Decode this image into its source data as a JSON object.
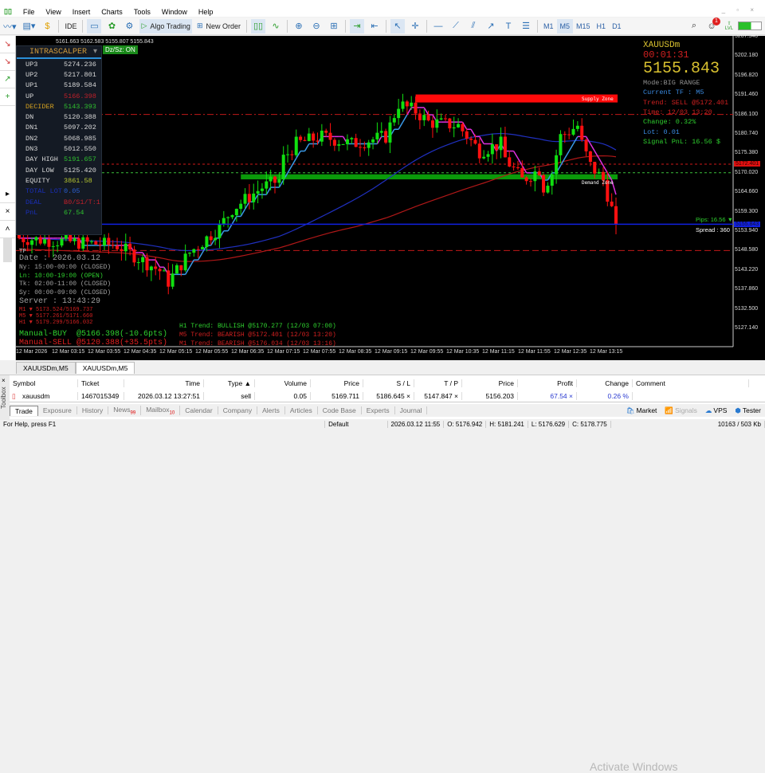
{
  "menu": [
    "File",
    "View",
    "Insert",
    "Charts",
    "Tools",
    "Window",
    "Help"
  ],
  "toolbar": {
    "algo_trading": "Algo Trading",
    "new_order": "New Order",
    "ide": "IDE",
    "timeframes": [
      "M1",
      "M5",
      "M15",
      "H1",
      "D1"
    ],
    "active_tf": "M5",
    "notifications": "1",
    "lvl": "LVL"
  },
  "chart": {
    "ohlc": "5161.663 5162.583 5155.807 5155.843",
    "dz_button": "Dz/Sz: ON",
    "panel": {
      "title": "INTRASCALPER",
      "rows": [
        {
          "k": "UP3",
          "v": "5274.236",
          "kc": "#d8d8d8",
          "vc": "#d8d8d8"
        },
        {
          "k": "UP2",
          "v": "5217.801",
          "kc": "#d8d8d8",
          "vc": "#d8d8d8"
        },
        {
          "k": "UP1",
          "v": "5189.584",
          "kc": "#d8d8d8",
          "vc": "#d8d8d8"
        },
        {
          "k": "UP",
          "v": "5166.398",
          "kc": "#d8d8d8",
          "vc": "#c0202a"
        },
        {
          "k": "DECIDER",
          "v": "5143.393",
          "kc": "#d3a020",
          "vc": "#2fc02f"
        },
        {
          "k": "DN",
          "v": "5120.388",
          "kc": "#d8d8d8",
          "vc": "#d8d8d8"
        },
        {
          "k": "DN1",
          "v": "5097.202",
          "kc": "#d8d8d8",
          "vc": "#d8d8d8"
        },
        {
          "k": "DN2",
          "v": "5068.985",
          "kc": "#d8d8d8",
          "vc": "#d8d8d8"
        },
        {
          "k": "DN3",
          "v": "5012.550",
          "kc": "#d8d8d8",
          "vc": "#d8d8d8"
        },
        {
          "k": "DAY HIGH",
          "v": "5191.657",
          "kc": "#d8d8d8",
          "vc": "#2fc02f"
        },
        {
          "k": "DAY LOW",
          "v": "5125.420",
          "kc": "#d8d8d8",
          "vc": "#d8d8d8"
        },
        {
          "k": "EQUITY",
          "v": "3861.58",
          "kc": "#d8d8d8",
          "vc": "#b8c830"
        },
        {
          "k": "TOTAL LOT",
          "v": "0.05",
          "kc": "#1a2fb8",
          "vc": "#2a5fd0"
        },
        {
          "k": "DEAL",
          "v": "B0/S1/T:1",
          "kc": "#1a2fb8",
          "vc": "#c0202a"
        },
        {
          "k": "PnL",
          "v": "67.54",
          "kc": "#1a2fb8",
          "vc": "#2fc02f"
        }
      ]
    },
    "right_info": [
      {
        "t": "XAUUSDm",
        "c": "#d8c030",
        "s": 11
      },
      {
        "t": "00:01:31",
        "c": "#d02020",
        "s": 12
      },
      {
        "t": "5155.843",
        "c": "#d8c030",
        "s": 20
      },
      {
        "t": "Mode:BIG RANGE",
        "c": "#909090",
        "s": 8.5
      },
      {
        "t": "Current TF : M5",
        "c": "#3a8ae0",
        "s": 8.5
      },
      {
        "t": "Trend: SELL @5172.401",
        "c": "#d02020",
        "s": 8.5
      },
      {
        "t": "Time: 12/03 13:20",
        "c": "#d02020",
        "s": 8.5
      },
      {
        "t": "Change: 0.32%",
        "c": "#2fd02f",
        "s": 8.5
      },
      {
        "t": "Lot: 0.01",
        "c": "#3a8ae0",
        "s": 8.5
      },
      {
        "t": "Signal PnL: 16.56 $",
        "c": "#2fd02f",
        "s": 8.5
      }
    ],
    "sessions": [
      {
        "t": "Date : 2026.03.12",
        "c": "#a0a0a0",
        "s": 10
      },
      {
        "t": "Ny: 15:00-00:00 (CLOSED)",
        "c": "#a0a0a0",
        "s": 8
      },
      {
        "t": "Ln: 10:00-19:00 (OPEN)",
        "c": "#2fd02f",
        "s": 8
      },
      {
        "t": "Tk: 02:00-11:00 (CLOSED)",
        "c": "#a0a0a0",
        "s": 8
      },
      {
        "t": "Sy: 00:00-09:00 (CLOSED)",
        "c": "#a0a0a0",
        "s": 8
      },
      {
        "t": "Server : 13:43:29",
        "c": "#a0a0a0",
        "s": 10
      },
      {
        "t": "M1 ▼ 5173.524/5169.737",
        "c": "#d02020",
        "s": 7
      },
      {
        "t": "M5 ▼ 5177.261/5171.660",
        "c": "#d02020",
        "s": 7
      },
      {
        "t": "H1 ▼ 5179.299/5166.032",
        "c": "#d02020",
        "s": 7
      },
      {
        "t": "Manual-BUY  @5166.398(-10.6pts)",
        "c": "#2fd02f",
        "s": 10
      },
      {
        "t": "Manual-SELL @5120.388(+35.5pts)",
        "c": "#e02020",
        "s": 10
      }
    ],
    "trends": [
      {
        "t": "H1 Trend: BULLISH @5170.277 (12/03 07:00)",
        "c": "#2fd02f"
      },
      {
        "t": "M5 Trend: BEARISH @5172.401 (12/03 13:20)",
        "c": "#d02020"
      },
      {
        "t": "M1 Trend: BEARISH @5176.034 (12/03 13:16)",
        "c": "#d02020"
      }
    ],
    "tp_label": "TP",
    "supply_label": "Supply Zone",
    "demand_label": "Demand Zone",
    "pips": "Pips: 16.56 ▼",
    "spread": "Spread : 360",
    "sell_price_tag": "5172.401",
    "bid_tag": "5155.843"
  },
  "chart_data": {
    "type": "candlestick",
    "symbol": "XAUUSDm",
    "timeframe": "M5",
    "ylim": [
      5125,
      5208.9
    ],
    "y_ticks": [
      "5207.540",
      "5202.180",
      "5196.820",
      "5191.460",
      "5186.100",
      "5180.740",
      "5175.380",
      "5170.020",
      "5164.660",
      "5159.300",
      "5153.940",
      "5148.580",
      "5143.220",
      "5137.860",
      "5132.500",
      "5127.140"
    ],
    "x_ticks": [
      "12 Mar 2026",
      "12 Mar 03:15",
      "12 Mar 03:55",
      "12 Mar 04:35",
      "12 Mar 05:15",
      "12 Mar 05:55",
      "12 Mar 06:35",
      "12 Mar 07:15",
      "12 Mar 07:55",
      "12 Mar 08:35",
      "12 Mar 09:15",
      "12 Mar 09:55",
      "12 Mar 10:35",
      "12 Mar 11:15",
      "12 Mar 11:55",
      "12 Mar 12:35",
      "12 Mar 13:15"
    ],
    "close_path": [
      [
        0,
        5152
      ],
      [
        23,
        5150
      ],
      [
        33,
        5143
      ],
      [
        35,
        5140
      ],
      [
        40,
        5148
      ],
      [
        47,
        5155
      ],
      [
        50,
        5160
      ],
      [
        57,
        5166
      ],
      [
        61,
        5168
      ],
      [
        62,
        5174
      ],
      [
        65,
        5178
      ],
      [
        71,
        5180
      ],
      [
        78,
        5178
      ],
      [
        86,
        5180
      ],
      [
        88,
        5186
      ],
      [
        89,
        5189
      ],
      [
        93,
        5187
      ],
      [
        96,
        5184
      ],
      [
        103,
        5183
      ],
      [
        108,
        5176
      ],
      [
        113,
        5178
      ],
      [
        114,
        5174
      ],
      [
        118,
        5168
      ],
      [
        122,
        5171
      ],
      [
        123,
        5166
      ],
      [
        125,
        5170
      ],
      [
        127,
        5180
      ],
      [
        131,
        5183
      ],
      [
        132,
        5178
      ],
      [
        134,
        5172
      ],
      [
        137,
        5168
      ],
      [
        139,
        5160
      ],
      [
        140,
        5155.843
      ]
    ],
    "levels": {
      "supply": [
        5189.4,
        5191.6
      ],
      "demand": [
        5168.2,
        5169.6
      ],
      "sell_line": 5172.401,
      "decider_line": 5170.02,
      "bid": 5155.843,
      "upper_dash": 5186.1,
      "lower_dash": 5148.58
    }
  },
  "tabs": [
    "XAUUSDm,M5",
    "XAUUSDm,M5"
  ],
  "toolbox": {
    "label": "Toolbox",
    "columns": [
      "Symbol",
      "Ticket",
      "Time",
      "Type ▲",
      "Volume",
      "Price",
      "S / L",
      "T / P",
      "Price",
      "Profit",
      "Change",
      "Comment"
    ],
    "row": [
      "xauusdm",
      "1467015349",
      "2026.03.12 13:27:51",
      "sell",
      "0.05",
      "5169.711",
      "5186.645 ×",
      "5147.847 ×",
      "5156.203",
      "67.54 ×",
      "0.26 %",
      ""
    ],
    "tabs": [
      {
        "l": "Trade"
      },
      {
        "l": "Exposure"
      },
      {
        "l": "History"
      },
      {
        "l": "News",
        "b": "99"
      },
      {
        "l": "Mailbox",
        "b": "10"
      },
      {
        "l": "Calendar"
      },
      {
        "l": "Company"
      },
      {
        "l": "Alerts"
      },
      {
        "l": "Articles"
      },
      {
        "l": "Code Base"
      },
      {
        "l": "Experts"
      },
      {
        "l": "Journal"
      }
    ],
    "right": [
      "Market",
      "Signals",
      "VPS",
      "Tester"
    ]
  },
  "watermark": "Activate Windows",
  "status": [
    "For Help, press F1",
    "Default",
    "2026.03.12 11:55",
    "O: 5176.942",
    "H: 5181.241",
    "L: 5176.629",
    "C: 5178.775",
    "10163 / 503 Kb"
  ]
}
